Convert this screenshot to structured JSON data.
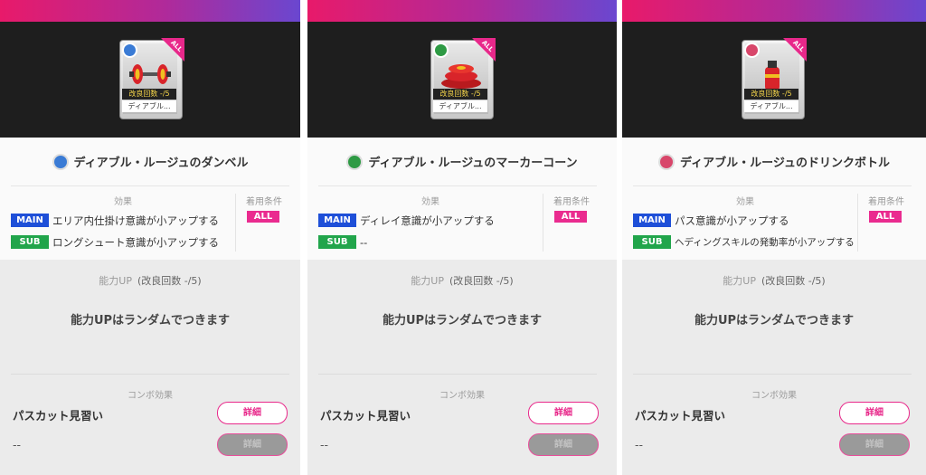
{
  "colors": {
    "accent": "#e8288a",
    "main_tag": "#1e4fd8",
    "sub_tag": "#21a54b",
    "bar_start": "#e81a6a",
    "bar_end": "#6a47d0"
  },
  "panels": [
    {
      "type_icon": "shirt-icon",
      "type_color": "#3a7bd5",
      "item_icon": "dumbbell-icon",
      "card": {
        "count": "改良回数 -/5",
        "name": "ディアブル...",
        "badge": "ALL"
      },
      "item_name": "ディアブル・ルージュのダンベル",
      "effect_label": "効果",
      "condition_label": "着用条件",
      "main_tag": "MAIN",
      "main_text": "エリア内仕掛け意識が小アップする",
      "sub_tag": "SUB",
      "sub_text": "ロングシュート意識が小アップする",
      "condition": "ALL",
      "ability_title": "能力UP",
      "ability_count": "(改良回数 -/5)",
      "ability_msg": "能力UPはランダムでつきます",
      "combo_title": "コンボ効果",
      "combo_name": "パスカット見習い",
      "combo_dash": "--",
      "detail_btn": "詳細",
      "detail_btn2": "詳細"
    },
    {
      "type_icon": "cone-icon",
      "type_color": "#2e9a44",
      "item_icon": "marker-cone-icon",
      "card": {
        "count": "改良回数 -/5",
        "name": "ディアブル...",
        "badge": "ALL"
      },
      "item_name": "ディアブル・ルージュのマーカーコーン",
      "effect_label": "効果",
      "condition_label": "着用条件",
      "main_tag": "MAIN",
      "main_text": "ディレイ意識が小アップする",
      "sub_tag": "SUB",
      "sub_text": "--",
      "condition": "ALL",
      "ability_title": "能力UP",
      "ability_count": "(改良回数 -/5)",
      "ability_msg": "能力UPはランダムでつきます",
      "combo_title": "コンボ効果",
      "combo_name": "パスカット見習い",
      "combo_dash": "--",
      "detail_btn": "詳細",
      "detail_btn2": "詳細"
    },
    {
      "type_icon": "bag-icon",
      "type_color": "#d8466a",
      "item_icon": "drink-bottle-icon",
      "card": {
        "count": "改良回数 -/5",
        "name": "ディアブル...",
        "badge": "ALL"
      },
      "item_name": "ディアブル・ルージュのドリンクボトル",
      "effect_label": "効果",
      "condition_label": "着用条件",
      "main_tag": "MAIN",
      "main_text": "パス意識が小アップする",
      "sub_tag": "SUB",
      "sub_text": "ヘディングスキルの発動率が小アップする",
      "condition": "ALL",
      "ability_title": "能力UP",
      "ability_count": "(改良回数 -/5)",
      "ability_msg": "能力UPはランダムでつきます",
      "combo_title": "コンボ効果",
      "combo_name": "パスカット見習い",
      "combo_dash": "--",
      "detail_btn": "詳細",
      "detail_btn2": "詳細"
    }
  ]
}
